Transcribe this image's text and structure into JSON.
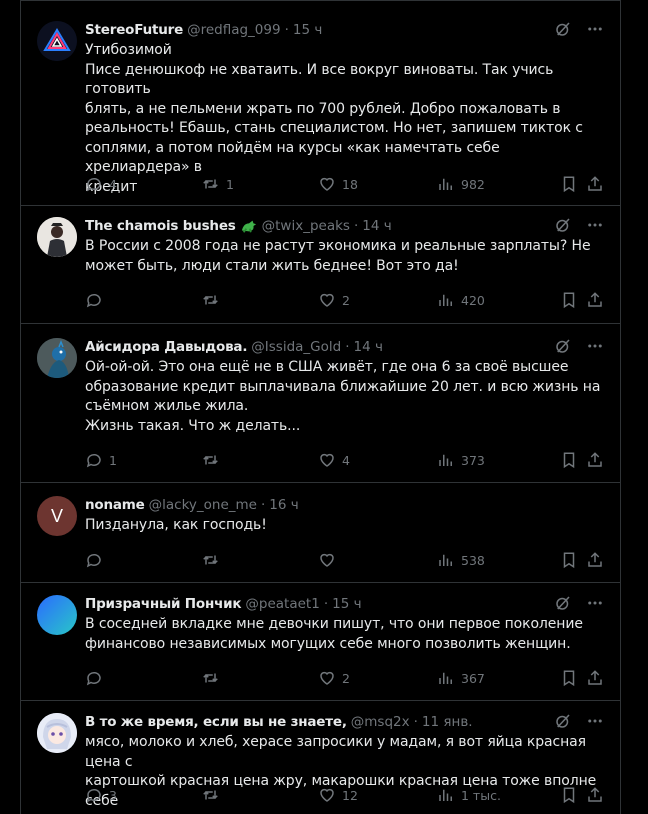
{
  "tweets": [
    {
      "name": "StereoFuture",
      "handle": "@redflag_099",
      "time": "15 ч",
      "text": "Утибозимой\nПисе денюшкоф не хватаить. И все вокруг виноваты. Так учись готовить\nблять, а не пельмени жрать по 700 рублей. Добро пожаловать в\nреальность! Ебашь, стань специалистом. Но нет, запишем тикток с\nсоплями, а потом пойдём на курсы «как намечтать себе хрелиардера» в\nкредит",
      "replies": "4",
      "retweets": "1",
      "likes": "18",
      "views": "982",
      "avatar_icon": "triangle-logo-icon"
    },
    {
      "name": "The chamois bushes",
      "handle": "@twix_peaks",
      "time": "14 ч",
      "text": "В России с 2008 года не растут экономика и реальные зарплаты? Не\nможет быть, люди стали жить беднее! Вот это да!",
      "replies": "",
      "retweets": "",
      "likes": "2",
      "views": "420",
      "avatar_icon": "portrait-photo",
      "badge_icon": "dragon-emoji-icon"
    },
    {
      "name": "Айсидора Давыдова.",
      "handle": "@Issida_Gold",
      "time": "14 ч",
      "text": "Ой-ой-ой. Это она ещё не в США живёт, где она 6 за своё высшее\nобразование кредит выплачивала ближайшие 20 лет. и всю жизнь на\nсъёмном жилье жила.\nЖизнь такая. Что ж делать...",
      "replies": "1",
      "retweets": "",
      "likes": "4",
      "views": "373",
      "avatar_icon": "peacock-photo"
    },
    {
      "name": "noname",
      "handle": "@lacky_one_me",
      "time": "16 ч",
      "text": "Пизданула, как господь!",
      "replies": "",
      "retweets": "",
      "likes": "",
      "views": "538",
      "avatar_letter": "V",
      "avatar_color": "#6d3530"
    },
    {
      "name": "Призрачный Пончик",
      "handle": "@peataet1",
      "time": "15 ч",
      "text": "В соседней вкладке мне девочки пишут, что они первое поколение\nфинансово независимых могущих себе много позволить женщин.",
      "replies": "",
      "retweets": "",
      "likes": "2",
      "views": "367",
      "avatar_icon": "gradient-avatar"
    },
    {
      "name": "В то же время, если вы не знаете,",
      "handle": "@msq2x",
      "time": "11 янв.",
      "text": "мясо, молоко и хлеб, херасе запросики у мадам, я вот яйца красная цена с\nкартошкой красная цена жру, макарошки красная цена тоже вполне себе",
      "replies": "3",
      "retweets": "",
      "likes": "12",
      "views": "1 тыс.",
      "avatar_icon": "anime-avatar"
    }
  ],
  "colors": {
    "background": "#000000",
    "text": "#e7e9ea",
    "muted": "#71767b",
    "border": "#2f3336"
  }
}
